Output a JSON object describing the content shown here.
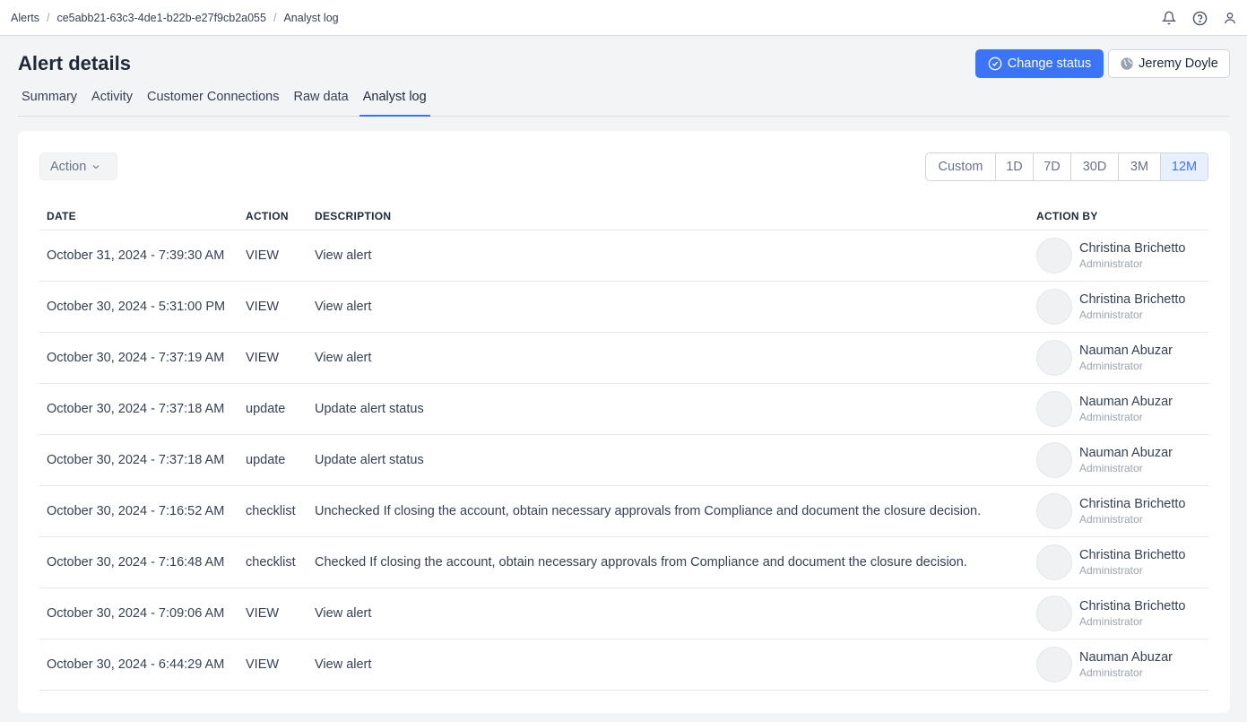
{
  "breadcrumb": [
    "Alerts",
    "ce5abb21-63c3-4de1-b22b-e27f9cb2a055",
    "Analyst log"
  ],
  "header": {
    "title": "Alert details",
    "change_status_label": "Change status",
    "assignee_label": "Jeremy Doyle"
  },
  "tabs": [
    {
      "label": "Summary",
      "active": false
    },
    {
      "label": "Activity",
      "active": false
    },
    {
      "label": "Customer Connections",
      "active": false
    },
    {
      "label": "Raw data",
      "active": false
    },
    {
      "label": "Analyst log",
      "active": true
    }
  ],
  "filter": {
    "label": "Action"
  },
  "ranges": [
    {
      "label": "Custom",
      "active": false
    },
    {
      "label": "1D",
      "active": false
    },
    {
      "label": "7D",
      "active": false
    },
    {
      "label": "30D",
      "active": false
    },
    {
      "label": "3M",
      "active": false
    },
    {
      "label": "12M",
      "active": true
    }
  ],
  "table": {
    "columns": [
      "DATE",
      "ACTION",
      "DESCRIPTION",
      "ACTION BY"
    ],
    "rows": [
      {
        "date": "October 31, 2024 - 7:39:30 AM",
        "action": "VIEW",
        "description": "View alert",
        "by": "Christina Brichetto",
        "role": "Administrator"
      },
      {
        "date": "October 30, 2024 - 5:31:00 PM",
        "action": "VIEW",
        "description": "View alert",
        "by": "Christina Brichetto",
        "role": "Administrator"
      },
      {
        "date": "October 30, 2024 - 7:37:19 AM",
        "action": "VIEW",
        "description": "View alert",
        "by": "Nauman Abuzar",
        "role": "Administrator"
      },
      {
        "date": "October 30, 2024 - 7:37:18 AM",
        "action": "update",
        "description": "Update alert status",
        "by": "Nauman Abuzar",
        "role": "Administrator"
      },
      {
        "date": "October 30, 2024 - 7:37:18 AM",
        "action": "update",
        "description": "Update alert status",
        "by": "Nauman Abuzar",
        "role": "Administrator"
      },
      {
        "date": "October 30, 2024 - 7:16:52 AM",
        "action": "checklist",
        "description": "Unchecked If closing the account, obtain necessary approvals from Compliance and document the closure decision.",
        "by": "Christina Brichetto",
        "role": "Administrator"
      },
      {
        "date": "October 30, 2024 - 7:16:48 AM",
        "action": "checklist",
        "description": "Checked If closing the account, obtain necessary approvals from Compliance and document the closure decision.",
        "by": "Christina Brichetto",
        "role": "Administrator"
      },
      {
        "date": "October 30, 2024 - 7:09:06 AM",
        "action": "VIEW",
        "description": "View alert",
        "by": "Christina Brichetto",
        "role": "Administrator"
      },
      {
        "date": "October 30, 2024 - 6:44:29 AM",
        "action": "VIEW",
        "description": "View alert",
        "by": "Nauman Abuzar",
        "role": "Administrator"
      }
    ]
  },
  "colors": {
    "accent": "#3b74f6",
    "background": "#f3f4f6"
  },
  "icons": {
    "notifications": "bell-icon",
    "help": "help-icon",
    "account": "user-icon",
    "status": "check-circle-icon",
    "assignee": "globe-icon",
    "dropdown": "chevron-down-icon"
  }
}
